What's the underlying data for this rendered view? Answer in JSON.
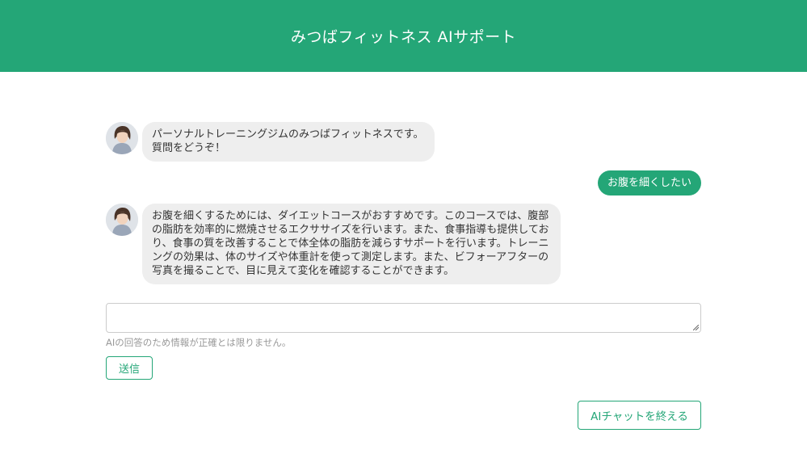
{
  "header": {
    "title": "みつばフィットネス AIサポート",
    "bg_color": "#24a677"
  },
  "messages": [
    {
      "role": "assistant",
      "avatar": "staff-avatar",
      "text": "パーソナルトレーニングジムのみつばフィットネスです。\n質問をどうぞ！"
    },
    {
      "role": "user",
      "text": "お腹を細くしたい"
    },
    {
      "role": "assistant",
      "avatar": "staff-avatar",
      "text": "お腹を細くするためには、ダイエットコースがおすすめです。このコースでは、腹部\nの脂肪を効率的に燃焼させるエクササイズを行います。また、食事指導も提供してお\nり、食事の質を改善することで体全体の脂肪を減らすサポートを行います。トレーニ\nングの効果は、体のサイズや体重計を使って測定します。また、ビフォーアフターの\n写真を撮ることで、目に見えて変化を確認することができます。"
    }
  ],
  "input": {
    "value": "",
    "placeholder": ""
  },
  "disclaimer": "AIの回答のため情報が正確とは限りません。",
  "buttons": {
    "send": "送信",
    "end_chat": "AIチャットを終える"
  },
  "colors": {
    "accent": "#24a677",
    "ai_bubble": "#eeeeee",
    "user_bubble": "#24a677"
  }
}
